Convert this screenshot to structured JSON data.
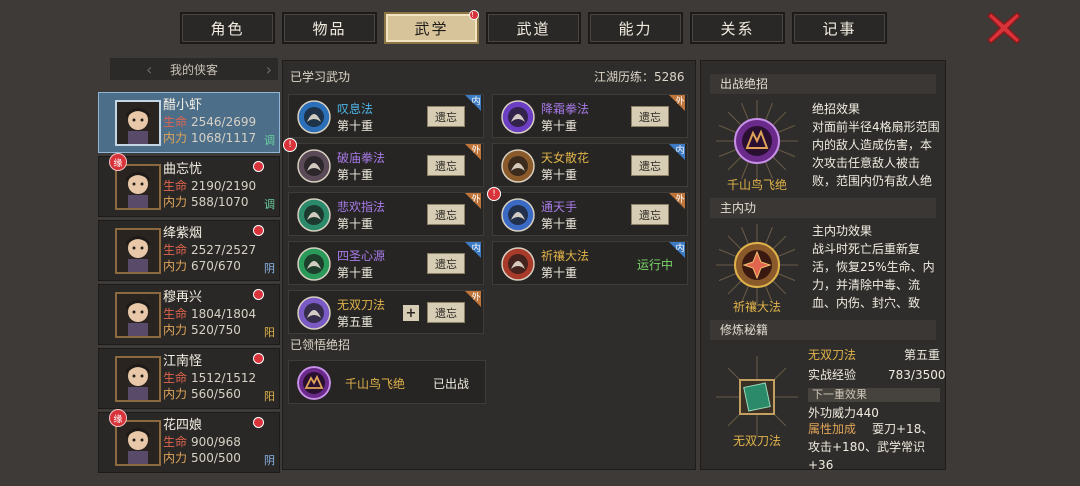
{
  "tabs": [
    {
      "label": "角色",
      "active": false
    },
    {
      "label": "物品",
      "active": false
    },
    {
      "label": "武学",
      "active": true,
      "alert": "!"
    },
    {
      "label": "武道",
      "active": false
    },
    {
      "label": "能力",
      "active": false
    },
    {
      "label": "关系",
      "active": false
    },
    {
      "label": "记事",
      "active": false
    }
  ],
  "sidebar": {
    "header": "我的侠客",
    "heroes": [
      {
        "name": "醋小虾",
        "hp_label": "生命",
        "hp": "2546/2699",
        "mp_label": "内力",
        "mp": "1068/1117",
        "attr": "调",
        "attr_color": "#6ad0a0",
        "active": true
      },
      {
        "name": "曲忘忧",
        "hp_label": "生命",
        "hp": "2190/2190",
        "mp_label": "内力",
        "mp": "588/1070",
        "attr": "调",
        "attr_color": "#6ad0a0",
        "bond": "缘"
      },
      {
        "name": "绛紫烟",
        "hp_label": "生命",
        "hp": "2527/2527",
        "mp_label": "内力",
        "mp": "670/670",
        "attr": "阴",
        "attr_color": "#8ab4e8"
      },
      {
        "name": "穆再兴",
        "hp_label": "生命",
        "hp": "1804/1804",
        "mp_label": "内力",
        "mp": "520/750",
        "attr": "阳",
        "attr_color": "#e0b34a"
      },
      {
        "name": "江南怪",
        "hp_label": "生命",
        "hp": "1512/1512",
        "mp_label": "内力",
        "mp": "560/560",
        "attr": "阳",
        "attr_color": "#e0b34a"
      },
      {
        "name": "花四娘",
        "hp_label": "生命",
        "hp": "900/968",
        "mp_label": "内力",
        "mp": "500/500",
        "attr": "阴",
        "attr_color": "#8ab4e8",
        "bond": "缘"
      }
    ]
  },
  "learned": {
    "title": "已学习武功",
    "exp_label": "江湖历练：5286",
    "forget_label": "遗忘",
    "running_label": "运行中",
    "skills": [
      {
        "name": "叹息法",
        "level": "第十重",
        "type": "内",
        "color": "#4fb4e8",
        "icon_color": "#2b6fb8"
      },
      {
        "name": "降霜拳法",
        "level": "第十重",
        "type": "外",
        "color": "#a87ae8",
        "icon_color": "#6b3ec4"
      },
      {
        "name": "破庙拳法",
        "level": "第十重",
        "type": "外",
        "color": "#a87ae8",
        "icon_color": "#5a4a58",
        "warn": "!"
      },
      {
        "name": "天女散花",
        "level": "第十重",
        "type": "内",
        "color": "#e0b34a",
        "icon_color": "#8a5a2a"
      },
      {
        "name": "悲欢指法",
        "level": "第十重",
        "type": "外",
        "color": "#a87ae8",
        "icon_color": "#2a8a6a"
      },
      {
        "name": "通天手",
        "level": "第十重",
        "type": "外",
        "color": "#a87ae8",
        "icon_color": "#3a6ac4",
        "warn": "!"
      },
      {
        "name": "四圣心源",
        "level": "第十重",
        "type": "内",
        "color": "#a87ae8",
        "icon_color": "#2a9a5a"
      },
      {
        "name": "祈禳大法",
        "level": "第十重",
        "type": "内",
        "color": "#e0b34a",
        "icon_color": "#a83a2a",
        "running": true
      },
      {
        "name": "无双刀法",
        "level": "第五重",
        "type": "外",
        "color": "#e0b34a",
        "icon_color": "#7a5ac4",
        "plus": "+"
      }
    ]
  },
  "ultimates": {
    "title": "已领悟绝招",
    "items": [
      {
        "name": "千山鸟飞绝",
        "status": "已出战"
      }
    ]
  },
  "right": {
    "battle_ult": {
      "header": "出战绝招",
      "ring_label": "千山鸟飞绝",
      "effect_title": "绝招效果",
      "effect_text": "对面前半径4格扇形范围内的敌人造成伤害，本次攻击任意敌人被击败，范围内仍有敌人绝"
    },
    "main_inner": {
      "header": "主内功",
      "ring_label": "祈禳大法",
      "effect_title": "主内功效果",
      "effect_text": "战斗时死亡后重新复活，恢复25%生命、内力，并清除中毒、流血、内伤、封穴、致盲、眩晕等状态"
    },
    "manual": {
      "header": "修炼秘籍",
      "ring_label": "无双刀法",
      "name": "无双刀法",
      "level": "第五重",
      "exp_label": "实战经验",
      "exp_value": "783/3500",
      "next_label": "下一重效果",
      "power": "外功威力440",
      "bonus_label": "属性加成",
      "bonus_text": "耍刀+18、攻击+180、武学常识+36"
    }
  }
}
